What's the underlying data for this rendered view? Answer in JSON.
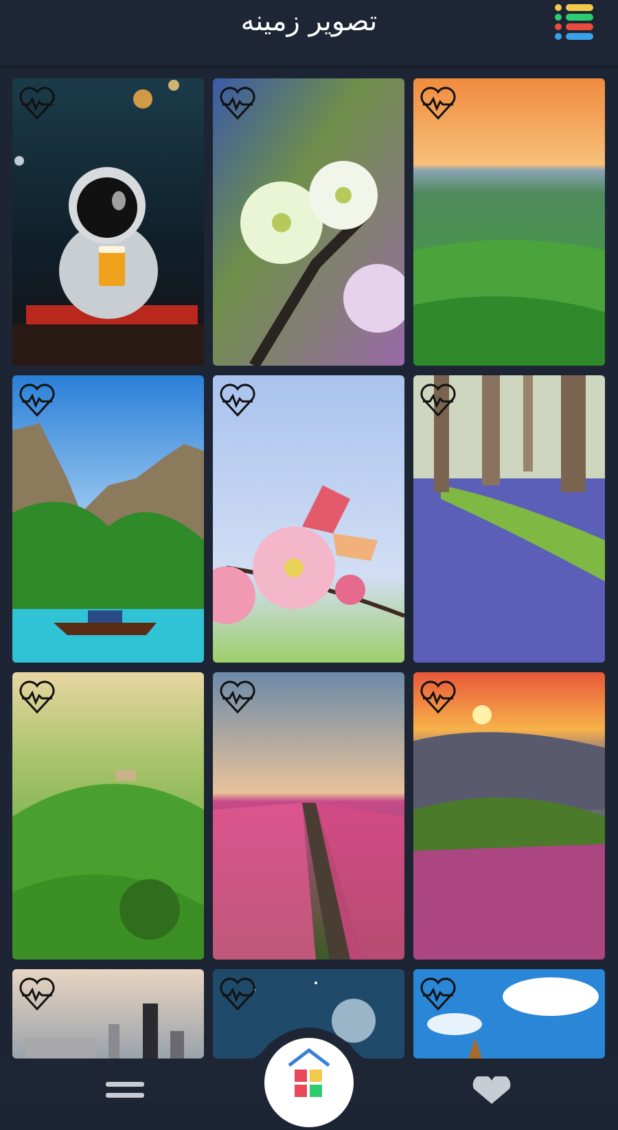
{
  "header": {
    "title": "تصویر زمینه",
    "menu_icon": "list-menu-icon",
    "menu_colors": [
      "#f2c94c",
      "#2ecc71",
      "#e74c3c",
      "#3aa0e8"
    ]
  },
  "favorite_icon": "heart-pulse-icon",
  "wallpapers": [
    {
      "name": "astronaut-bar"
    },
    {
      "name": "white-blossom"
    },
    {
      "name": "green-hills-sunset"
    },
    {
      "name": "tropical-cliffs-boat"
    },
    {
      "name": "butterfly-pink-flower"
    },
    {
      "name": "bluebell-forest"
    },
    {
      "name": "tuscany-hills"
    },
    {
      "name": "tulip-field"
    },
    {
      "name": "mountain-sunset-flowers"
    },
    {
      "name": "city-skyline"
    },
    {
      "name": "space-planet"
    },
    {
      "name": "blue-sky-clouds"
    }
  ],
  "bottom_nav": {
    "left_icon": "list-icon",
    "center_icon": "home-colorful-icon",
    "right_icon": "heart-icon"
  }
}
